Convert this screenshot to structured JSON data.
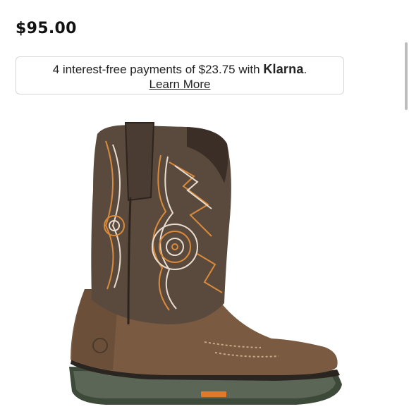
{
  "product": {
    "price": "$95.00",
    "image_alt": "Brown western boot with orange and white embroidered stitching"
  },
  "klarna": {
    "text_before": "4 interest-free payments of $23.75 with ",
    "brand": "Klarna",
    "text_after": ".",
    "link_label": "Learn More"
  },
  "colors": {
    "boot_shaft": "#5a4a3e",
    "boot_vamp": "#7a5a40",
    "stitch_orange": "#d98a3a",
    "stitch_white": "#e8ddd0",
    "sole": "#3d4a3a"
  }
}
